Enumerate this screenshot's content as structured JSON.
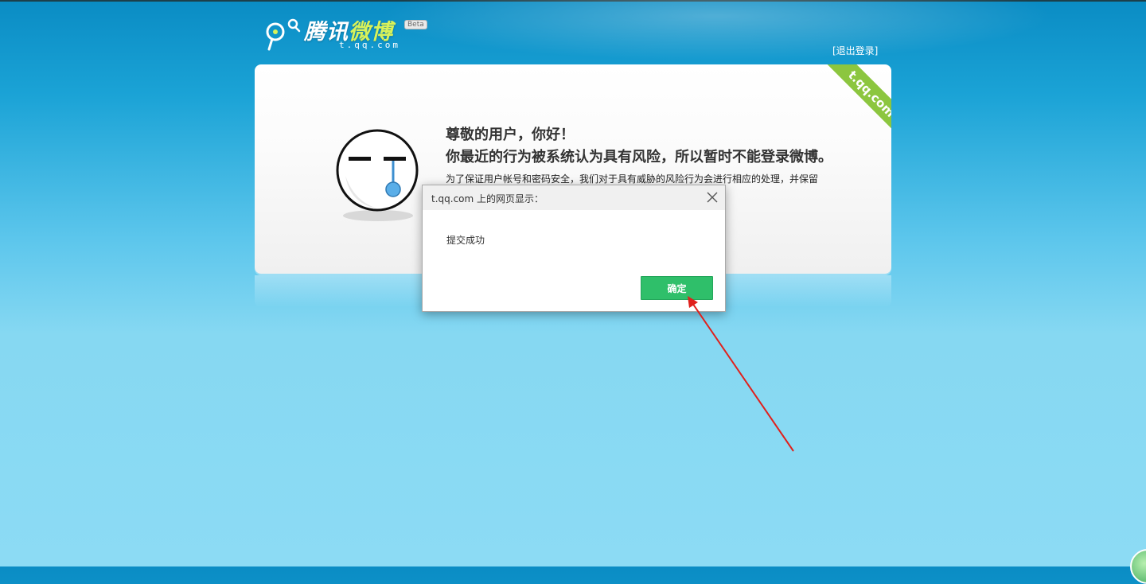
{
  "header": {
    "logo_text_main": "腾讯",
    "logo_text_accent": "微博",
    "logo_url": "t.qq.com",
    "beta_badge": "Beta",
    "logout_label": "[退出登录]"
  },
  "card": {
    "ribbon_text": "t.qq.com",
    "greeting": "尊敬的用户，你好！",
    "notice": "你最近的行为被系统认为具有风险，所以暂时不能登录微博。",
    "detail": "为了保证用户帐号和密码安全，我们对于具有威胁的风险行为会进行相应的处理，并保留"
  },
  "dialog": {
    "title": "t.qq.com 上的网页显示：",
    "message": "提交成功",
    "ok_label": "确定"
  },
  "colors": {
    "ok_button": "#2fbf6a",
    "ribbon": "#8cc63f",
    "arrow": "#e0201c",
    "logo_accent": "#d8f25a"
  }
}
